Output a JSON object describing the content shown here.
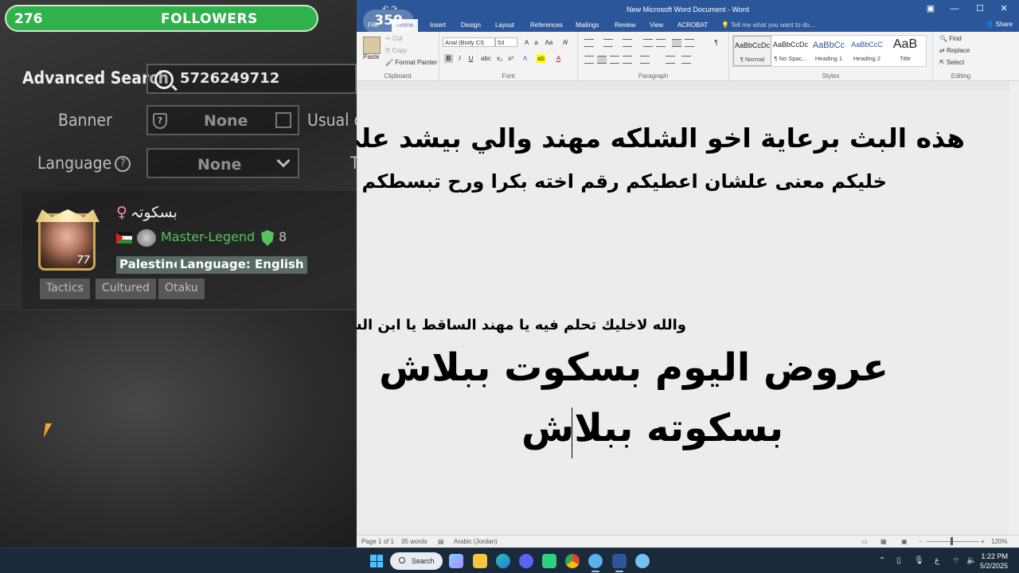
{
  "overlay": {
    "followers_count": "276",
    "followers_label": "FOLLOWERS",
    "followers_goal": "350"
  },
  "game": {
    "advanced_search_label": "Advanced Search",
    "search_value": "5726249712",
    "banner_label": "Banner",
    "banner_value": "None",
    "usual_label": "Usual or",
    "language_label": "Language",
    "language_help": "?",
    "language_value": "None",
    "language_truncated": "T",
    "player": {
      "name": "بسكوتہ",
      "gender_symbol": "♀",
      "avatar_level": "77",
      "rank": "Master-Legend",
      "rank_number": "8",
      "country": "Palestine",
      "language": "Language: English",
      "tags": [
        "Tactics",
        "Cultured",
        "Otaku"
      ]
    }
  },
  "word": {
    "title": "New Microsoft Word Document - Word",
    "tabs": [
      "File",
      "Home",
      "Insert",
      "Design",
      "Layout",
      "References",
      "Mailings",
      "Review",
      "View",
      "ACROBAT"
    ],
    "active_tab": "Home",
    "tell_me": "Tell me what you want to do...",
    "share": "Share",
    "clipboard": {
      "paste": "Paste",
      "cut": "Cut",
      "copy": "Copy",
      "format_painter": "Format Painter",
      "title": "Clipboard"
    },
    "font": {
      "name": "Arial (Body CS",
      "size": "53",
      "title": "Font"
    },
    "paragraph_title": "Paragraph",
    "styles": {
      "title": "Styles",
      "items": [
        {
          "preview": "AaBbCcDc",
          "name": "¶ Normal"
        },
        {
          "preview": "AaBbCcDc",
          "name": "¶ No Spac..."
        },
        {
          "preview": "AaBbCc",
          "name": "Heading 1"
        },
        {
          "preview": "AaBbCcC",
          "name": "Heading 2"
        },
        {
          "preview": "AaB",
          "name": "Title"
        }
      ]
    },
    "editing": {
      "find": "Find",
      "replace": "Replace",
      "select": "Select",
      "title": "Editing"
    },
    "document": {
      "line1": "هذه البث برعاية اخو الشلكه مهند والي بيشد على ايده",
      "line2": "خليكم معنى علشان اعطيكم رقم اخته بكرا ورح تبسطكم",
      "line3": "والله لاخليك تحلم فيه يا مهند الساقط يا ابن الساقط",
      "line4": "عروض اليوم بسكوت ببلاش",
      "line5": "بسكوته ببلاش"
    },
    "status": {
      "page": "Page 1 of 1",
      "words": "35 words",
      "language": "Arabic (Jordan)",
      "zoom": "120%"
    }
  },
  "taskbar": {
    "search_label": "Search",
    "time": "1:22 PM",
    "date": "5/2/2025",
    "input_lang": "ع"
  }
}
